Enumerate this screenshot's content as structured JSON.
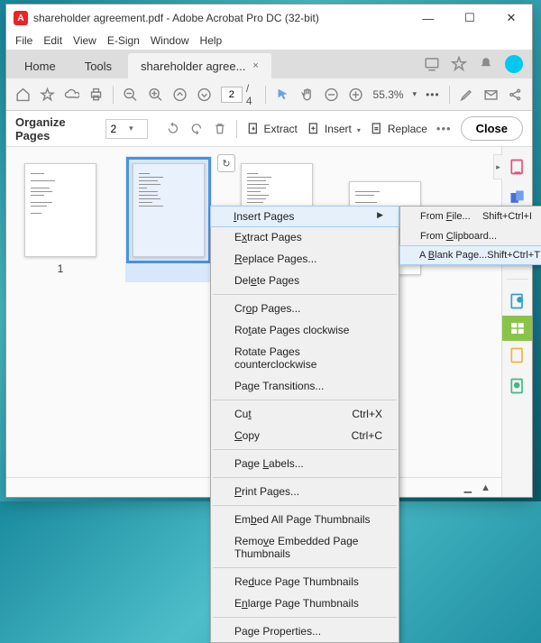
{
  "titlebar": {
    "title": "shareholder agreement.pdf - Adobe Acrobat Pro DC (32-bit)"
  },
  "menu": {
    "file": "File",
    "edit": "Edit",
    "view": "View",
    "esign": "E-Sign",
    "window": "Window",
    "help": "Help"
  },
  "tabs": {
    "home": "Home",
    "tools": "Tools",
    "doc": "shareholder agree...",
    "close": "×"
  },
  "toolbar1": {
    "page_current": "2",
    "page_total": "/  4",
    "zoom": "55.3%",
    "zoomdd": "▾",
    "more": "•••"
  },
  "toolbar2": {
    "title": "Organize Pages",
    "page": "2",
    "extract": "Extract",
    "insert": "Insert",
    "replace": "Replace",
    "close": "Close",
    "more": "•••"
  },
  "thumbs": {
    "p1": "1",
    "p2": "",
    "p3": "",
    "p4": ""
  },
  "ctx": {
    "insert_pages": "Insert Pages",
    "extract": "Extract Pages",
    "replace": "Replace Pages...",
    "delete": "Delete Pages",
    "crop": "Crop Pages...",
    "rot_cw": "Rotate Pages clockwise",
    "rot_ccw": "Rotate Pages counterclockwise",
    "transitions": "Page Transitions...",
    "cut": "Cut",
    "cut_sc": "Ctrl+X",
    "copy": "Copy",
    "copy_sc": "Ctrl+C",
    "labels": "Page Labels...",
    "print": "Print Pages...",
    "embed": "Embed All Page Thumbnails",
    "remove": "Remove Embedded Page Thumbnails",
    "reduce": "Reduce Page Thumbnails",
    "enlarge": "Enlarge Page Thumbnails",
    "props": "Page Properties..."
  },
  "sub": {
    "from_file": "From File...",
    "from_file_sc": "Shift+Ctrl+I",
    "from_clip": "From Clipboard...",
    "blank": "A Blank Page...",
    "blank_sc": "Shift+Ctrl+T"
  }
}
